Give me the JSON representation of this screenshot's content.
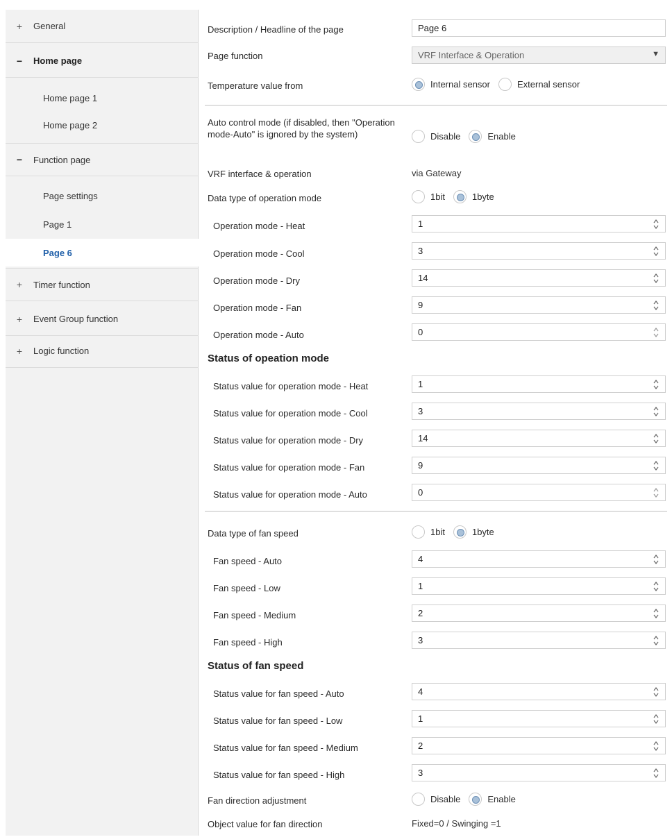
{
  "sidebar": {
    "general": "General",
    "home_page": "Home page",
    "home_page_1": "Home page 1",
    "home_page_2": "Home page 2",
    "function_page": "Function page",
    "page_settings": "Page settings",
    "page_1": "Page 1",
    "page_6": "Page 6",
    "timer_function": "Timer function",
    "event_group_function": "Event Group function",
    "logic_function": "Logic function",
    "plus": "+",
    "minus": "−"
  },
  "form": {
    "description_label": "Description / Headline of the page",
    "description_value": "Page 6",
    "page_function_label": "Page function",
    "page_function_value": "VRF Interface & Operation",
    "temp_label": "Temperature value from",
    "temp_internal": "Internal sensor",
    "temp_external": "External sensor",
    "auto_label": "Auto control mode (if disabled, then \"Operation mode-Auto\" is ignored by the system)",
    "disable": "Disable",
    "enable": "Enable",
    "vrf_label": "VRF interface & operation",
    "vrf_value": "via Gateway",
    "op_data_type_label": "Data type of operation mode",
    "opt_1bit": "1bit",
    "opt_1byte": "1byte",
    "op_mode": [
      {
        "label": "Operation mode - Heat",
        "value": "1"
      },
      {
        "label": "Operation mode - Cool",
        "value": "3"
      },
      {
        "label": "Operation mode - Dry",
        "value": "14"
      },
      {
        "label": "Operation mode - Fan",
        "value": "9"
      },
      {
        "label": "Operation mode - Auto",
        "value": "0"
      }
    ],
    "status_op_heading": "Status of opeation mode",
    "status_op": [
      {
        "label": "Status value for operation mode - Heat",
        "value": "1"
      },
      {
        "label": "Status value for operation mode - Cool",
        "value": "3"
      },
      {
        "label": "Status value for operation mode - Dry",
        "value": "14"
      },
      {
        "label": "Status value for operation mode - Fan",
        "value": "9"
      },
      {
        "label": "Status value for operation mode - Auto",
        "value": "0"
      }
    ],
    "fan_data_type_label": "Data type of fan speed",
    "fan_speed": [
      {
        "label": "Fan speed - Auto",
        "value": "4"
      },
      {
        "label": "Fan speed - Low",
        "value": "1"
      },
      {
        "label": "Fan speed - Medium",
        "value": "2"
      },
      {
        "label": "Fan speed - High",
        "value": "3"
      }
    ],
    "status_fan_heading": "Status of fan speed",
    "status_fan": [
      {
        "label": "Status value for fan speed - Auto",
        "value": "4"
      },
      {
        "label": "Status value for fan speed - Low",
        "value": "1"
      },
      {
        "label": "Status value for fan speed - Medium",
        "value": "2"
      },
      {
        "label": "Status value for fan speed - High",
        "value": "3"
      }
    ],
    "fan_dir_label": "Fan direction adjustment",
    "fan_dir_obj_label": "Object value for fan direction",
    "fan_dir_obj_value": "Fixed=0 / Swinging =1"
  },
  "colors": {
    "active_nav": "#1e5ea8",
    "radio_selected": "#a9c1d9",
    "sidebar_bg": "#f2f2f2"
  }
}
